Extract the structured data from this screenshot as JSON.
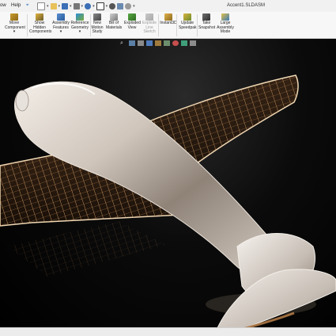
{
  "menubar": {
    "items": [
      "ow",
      "Help"
    ]
  },
  "document": {
    "title": "Accent1.SLDASM"
  },
  "ribbon": {
    "buttons": [
      {
        "id": "move-component",
        "label": "Move\nComponent",
        "has_menu": true
      },
      {
        "id": "show-hidden",
        "label": "Show\nHidden\nComponents"
      },
      {
        "id": "assembly-features",
        "label": "Assembly\nFeatures",
        "has_menu": true
      },
      {
        "id": "reference-geometry",
        "label": "Reference\nGeometry",
        "has_menu": true
      },
      {
        "id": "new-motion-study",
        "label": "New\nMotion\nStudy"
      },
      {
        "id": "bill-of-materials",
        "label": "Bill of\nMaterials"
      },
      {
        "id": "exploded-view",
        "label": "Exploded\nView"
      },
      {
        "id": "explode-line-sketch",
        "label": "Explode\nLine\nSketch",
        "disabled": true
      },
      {
        "id": "instant3d",
        "label": "Instant3D"
      },
      {
        "id": "update-speedpak",
        "label": "Update\nSpeedpak"
      },
      {
        "id": "take-snapshot",
        "label": "Take\nSnapshot"
      },
      {
        "id": "large-assembly-mode",
        "label": "Large\nAssembly\nMode"
      }
    ]
  },
  "colors": {
    "accent": "#2a6ebb",
    "wing_rib": "#d9a36a",
    "fuselage": "#d8d0c8",
    "background": "#000000"
  },
  "icons": [
    "search-icon",
    "zoom-area-icon",
    "section-view-icon",
    "view-orientation-icon",
    "display-style-icon",
    "hide-show-icon",
    "appearance-icon",
    "scene-icon",
    "view-settings-icon"
  ]
}
